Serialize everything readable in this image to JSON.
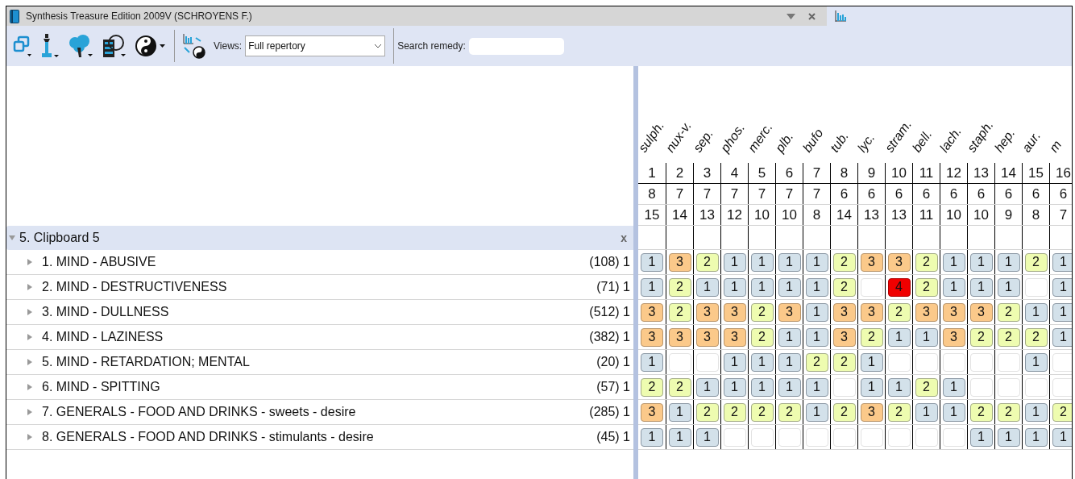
{
  "window": {
    "title": "Synthesis Treasure Edition 2009V (SCHROYENS F.)"
  },
  "toolbar": {
    "views_label": "Views:",
    "views_value": "Full repertory",
    "search_label": "Search remedy:"
  },
  "clipboard": {
    "title": "5. Clipboard 5",
    "close": "x",
    "expanded": true
  },
  "remedies": [
    {
      "name": "sulph.",
      "number": "1",
      "count": "8",
      "score": "15"
    },
    {
      "name": "nux-v.",
      "number": "2",
      "count": "7",
      "score": "14"
    },
    {
      "name": "sep.",
      "number": "3",
      "count": "7",
      "score": "13"
    },
    {
      "name": "phos.",
      "number": "4",
      "count": "7",
      "score": "12"
    },
    {
      "name": "merc.",
      "number": "5",
      "count": "7",
      "score": "10"
    },
    {
      "name": "plb.",
      "number": "6",
      "count": "7",
      "score": "10"
    },
    {
      "name": "bufo",
      "number": "7",
      "count": "7",
      "score": "8"
    },
    {
      "name": "tub.",
      "number": "8",
      "count": "6",
      "score": "14"
    },
    {
      "name": "lyc.",
      "number": "9",
      "count": "6",
      "score": "13"
    },
    {
      "name": "stram.",
      "number": "10",
      "count": "6",
      "score": "13"
    },
    {
      "name": "bell.",
      "number": "11",
      "count": "6",
      "score": "11"
    },
    {
      "name": "lach.",
      "number": "12",
      "count": "6",
      "score": "10"
    },
    {
      "name": "staph.",
      "number": "13",
      "count": "6",
      "score": "10"
    },
    {
      "name": "hep.",
      "number": "14",
      "count": "6",
      "score": "9"
    },
    {
      "name": "aur.",
      "number": "15",
      "count": "6",
      "score": "8"
    },
    {
      "name": "m",
      "number": "16",
      "count": "6",
      "score": "7"
    }
  ],
  "rubrics": [
    {
      "label": "1. MIND - ABUSIVE",
      "count": "(108) 1",
      "expanded": false,
      "cells": [
        {
          "kind": "graded",
          "grade": "1"
        },
        {
          "kind": "graded",
          "grade": "3"
        },
        {
          "kind": "graded",
          "grade": "2"
        },
        {
          "kind": "graded",
          "grade": "1"
        },
        {
          "kind": "graded",
          "grade": "1"
        },
        {
          "kind": "graded",
          "grade": "1"
        },
        {
          "kind": "graded",
          "grade": "1"
        },
        {
          "kind": "graded",
          "grade": "2"
        },
        {
          "kind": "graded",
          "grade": "3"
        },
        {
          "kind": "graded",
          "grade": "3"
        },
        {
          "kind": "graded",
          "grade": "2"
        },
        {
          "kind": "graded",
          "grade": "1"
        },
        {
          "kind": "graded",
          "grade": "1"
        },
        {
          "kind": "graded",
          "grade": "1"
        },
        {
          "kind": "graded",
          "grade": "2"
        },
        {
          "kind": "graded",
          "grade": "1"
        }
      ]
    },
    {
      "label": "2. MIND - DESTRUCTIVENESS",
      "count": "(71) 1",
      "expanded": false,
      "cells": [
        {
          "kind": "graded",
          "grade": "1"
        },
        {
          "kind": "graded",
          "grade": "2"
        },
        {
          "kind": "graded",
          "grade": "1"
        },
        {
          "kind": "graded",
          "grade": "1"
        },
        {
          "kind": "graded",
          "grade": "1"
        },
        {
          "kind": "graded",
          "grade": "1"
        },
        {
          "kind": "graded",
          "grade": "1"
        },
        {
          "kind": "graded",
          "grade": "2"
        },
        {
          "kind": "empty"
        },
        {
          "kind": "graded",
          "grade": "4"
        },
        {
          "kind": "graded",
          "grade": "2"
        },
        {
          "kind": "graded",
          "grade": "1"
        },
        {
          "kind": "graded",
          "grade": "1"
        },
        {
          "kind": "graded",
          "grade": "1"
        },
        {
          "kind": "empty"
        },
        {
          "kind": "graded",
          "grade": "1"
        }
      ]
    },
    {
      "label": "3. MIND - DULLNESS",
      "count": "(512) 1",
      "expanded": false,
      "cells": [
        {
          "kind": "graded",
          "grade": "3"
        },
        {
          "kind": "graded",
          "grade": "2"
        },
        {
          "kind": "graded",
          "grade": "3"
        },
        {
          "kind": "graded",
          "grade": "3"
        },
        {
          "kind": "graded",
          "grade": "2"
        },
        {
          "kind": "graded",
          "grade": "3"
        },
        {
          "kind": "graded",
          "grade": "1"
        },
        {
          "kind": "graded",
          "grade": "3"
        },
        {
          "kind": "graded",
          "grade": "3"
        },
        {
          "kind": "graded",
          "grade": "2"
        },
        {
          "kind": "graded",
          "grade": "3"
        },
        {
          "kind": "graded",
          "grade": "3"
        },
        {
          "kind": "graded",
          "grade": "3"
        },
        {
          "kind": "graded",
          "grade": "2"
        },
        {
          "kind": "graded",
          "grade": "1"
        },
        {
          "kind": "graded",
          "grade": "1"
        }
      ]
    },
    {
      "label": "4. MIND - LAZINESS",
      "count": "(382) 1",
      "expanded": false,
      "cells": [
        {
          "kind": "graded",
          "grade": "3"
        },
        {
          "kind": "graded",
          "grade": "3"
        },
        {
          "kind": "graded",
          "grade": "3"
        },
        {
          "kind": "graded",
          "grade": "3"
        },
        {
          "kind": "graded",
          "grade": "2"
        },
        {
          "kind": "graded",
          "grade": "1"
        },
        {
          "kind": "graded",
          "grade": "1"
        },
        {
          "kind": "graded",
          "grade": "3"
        },
        {
          "kind": "graded",
          "grade": "2"
        },
        {
          "kind": "graded",
          "grade": "1"
        },
        {
          "kind": "graded",
          "grade": "1"
        },
        {
          "kind": "graded",
          "grade": "3"
        },
        {
          "kind": "graded",
          "grade": "2"
        },
        {
          "kind": "graded",
          "grade": "2"
        },
        {
          "kind": "graded",
          "grade": "2"
        },
        {
          "kind": "graded",
          "grade": "1"
        }
      ]
    },
    {
      "label": "5. MIND - RETARDATION; MENTAL",
      "count": "(20) 1",
      "expanded": false,
      "cells": [
        {
          "kind": "graded",
          "grade": "1"
        },
        {
          "kind": "empty"
        },
        {
          "kind": "empty"
        },
        {
          "kind": "graded",
          "grade": "1"
        },
        {
          "kind": "graded",
          "grade": "1"
        },
        {
          "kind": "graded",
          "grade": "1"
        },
        {
          "kind": "graded",
          "grade": "2"
        },
        {
          "kind": "graded",
          "grade": "2"
        },
        {
          "kind": "graded",
          "grade": "1"
        },
        {
          "kind": "empty"
        },
        {
          "kind": "empty"
        },
        {
          "kind": "empty"
        },
        {
          "kind": "empty"
        },
        {
          "kind": "empty"
        },
        {
          "kind": "graded",
          "grade": "1"
        },
        {
          "kind": "empty"
        }
      ]
    },
    {
      "label": "6. MIND - SPITTING",
      "count": "(57) 1",
      "expanded": false,
      "cells": [
        {
          "kind": "graded",
          "grade": "2"
        },
        {
          "kind": "graded",
          "grade": "2"
        },
        {
          "kind": "graded",
          "grade": "1"
        },
        {
          "kind": "graded",
          "grade": "1"
        },
        {
          "kind": "graded",
          "grade": "1"
        },
        {
          "kind": "graded",
          "grade": "1"
        },
        {
          "kind": "graded",
          "grade": "1"
        },
        {
          "kind": "empty"
        },
        {
          "kind": "graded",
          "grade": "1"
        },
        {
          "kind": "graded",
          "grade": "1"
        },
        {
          "kind": "graded",
          "grade": "2"
        },
        {
          "kind": "graded",
          "grade": "1"
        },
        {
          "kind": "empty"
        },
        {
          "kind": "empty"
        },
        {
          "kind": "empty"
        },
        {
          "kind": "empty"
        }
      ]
    },
    {
      "label": "7. GENERALS - FOOD AND DRINKS - sweets - desire",
      "count": "(285) 1",
      "expanded": false,
      "cells": [
        {
          "kind": "graded",
          "grade": "3"
        },
        {
          "kind": "graded",
          "grade": "1"
        },
        {
          "kind": "graded",
          "grade": "2"
        },
        {
          "kind": "graded",
          "grade": "2"
        },
        {
          "kind": "graded",
          "grade": "2"
        },
        {
          "kind": "graded",
          "grade": "2"
        },
        {
          "kind": "graded",
          "grade": "1"
        },
        {
          "kind": "graded",
          "grade": "2"
        },
        {
          "kind": "graded",
          "grade": "3"
        },
        {
          "kind": "graded",
          "grade": "2"
        },
        {
          "kind": "graded",
          "grade": "1"
        },
        {
          "kind": "graded",
          "grade": "1"
        },
        {
          "kind": "graded",
          "grade": "2"
        },
        {
          "kind": "graded",
          "grade": "2"
        },
        {
          "kind": "graded",
          "grade": "1"
        },
        {
          "kind": "graded",
          "grade": "2"
        }
      ]
    },
    {
      "label": "8. GENERALS - FOOD AND DRINKS - stimulants - desire",
      "count": "(45) 1",
      "expanded": false,
      "cells": [
        {
          "kind": "graded",
          "grade": "1"
        },
        {
          "kind": "graded",
          "grade": "1"
        },
        {
          "kind": "graded",
          "grade": "1"
        },
        {
          "kind": "empty"
        },
        {
          "kind": "empty"
        },
        {
          "kind": "empty"
        },
        {
          "kind": "empty"
        },
        {
          "kind": "empty"
        },
        {
          "kind": "empty"
        },
        {
          "kind": "empty"
        },
        {
          "kind": "empty"
        },
        {
          "kind": "empty"
        },
        {
          "kind": "graded",
          "grade": "1"
        },
        {
          "kind": "graded",
          "grade": "1"
        },
        {
          "kind": "graded",
          "grade": "1"
        },
        {
          "kind": "graded",
          "grade": "1"
        }
      ]
    }
  ]
}
